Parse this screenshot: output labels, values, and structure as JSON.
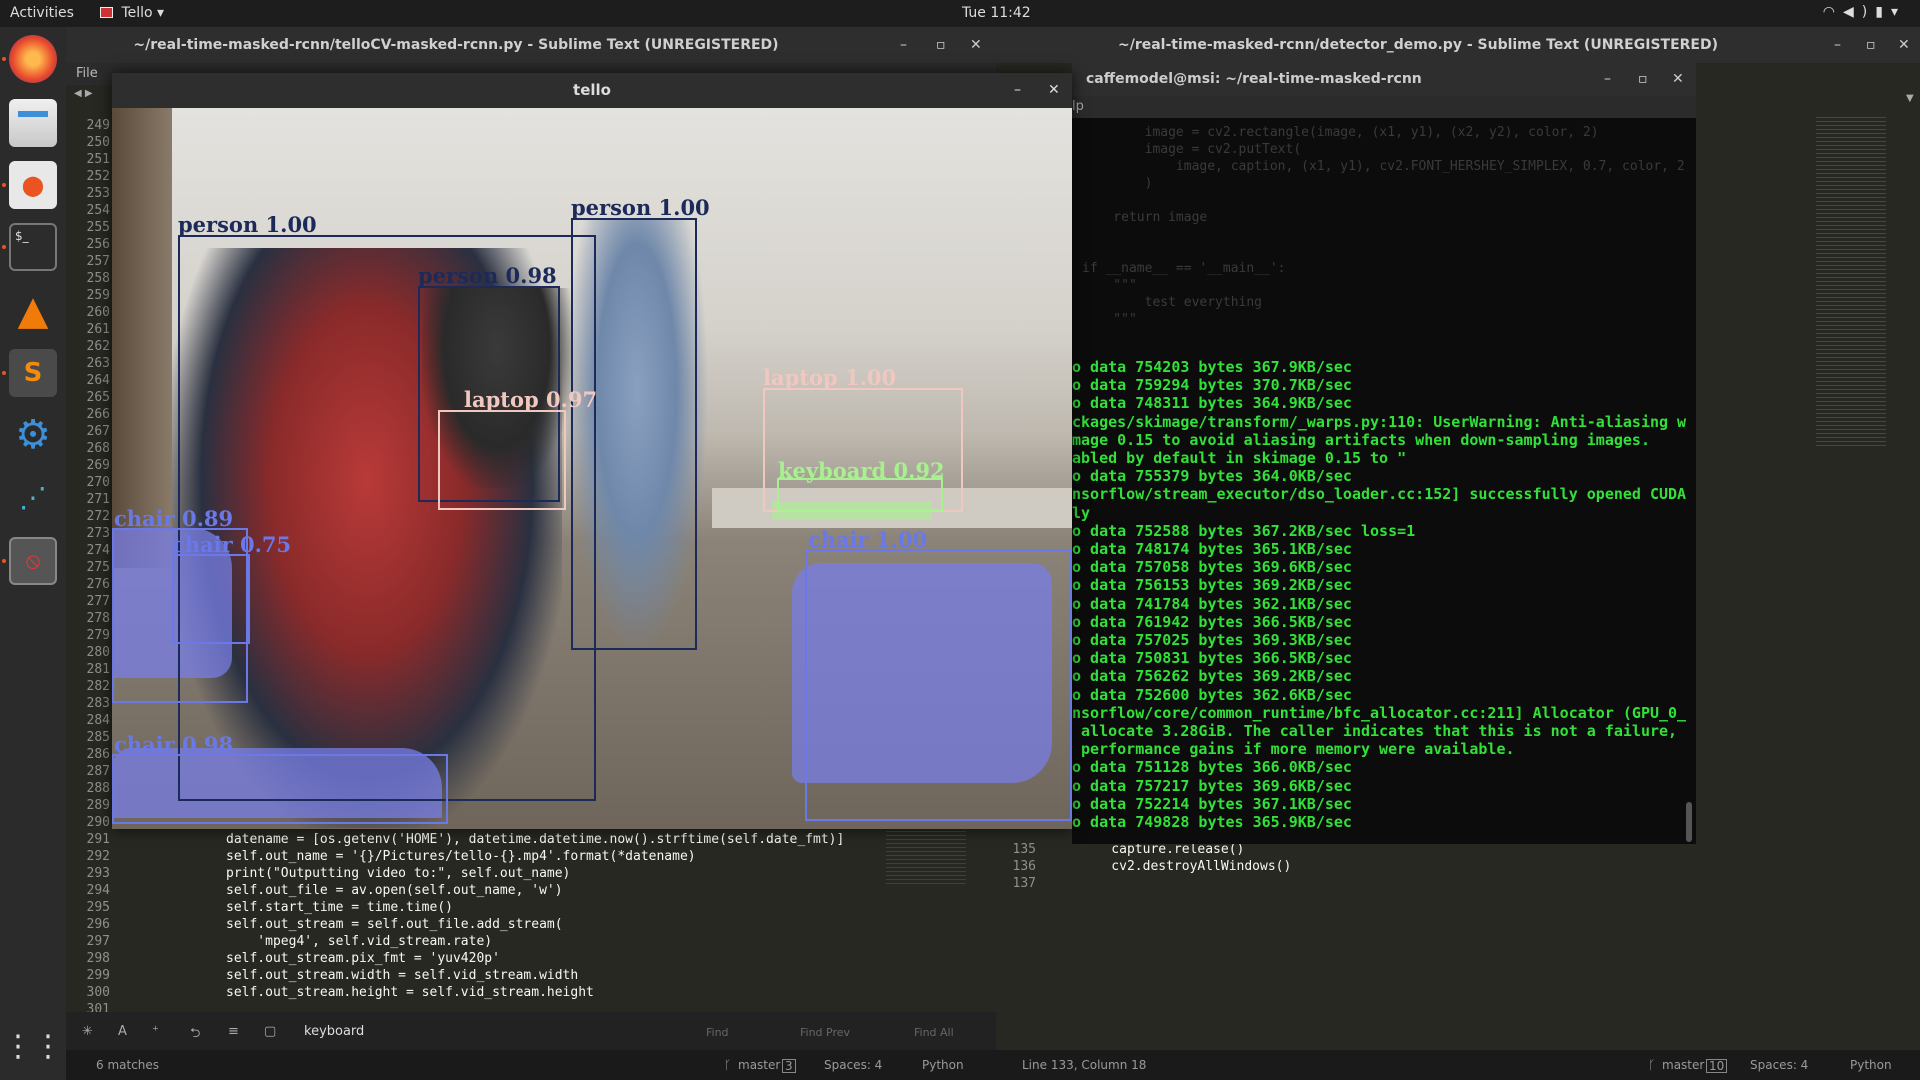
{
  "topbar": {
    "activities": "Activities",
    "app_name": "Tello",
    "clock": "Tue 11:42"
  },
  "dock": {
    "icons": [
      "firefox-icon",
      "files-icon",
      "software-icon",
      "terminal-icon",
      "vlc-icon",
      "sublime-icon",
      "settings-icon",
      "network-icon",
      "blocked-app-icon",
      "app-grid-icon"
    ]
  },
  "editor_left": {
    "title": "~/real-time-masked-rcnn/telloCV-masked-rcnn.py - Sublime Text (UNREGISTERED)",
    "menu_file": "File",
    "line_numbers": [
      "249",
      "250",
      "251",
      "252",
      "253",
      "254",
      "255",
      "256",
      "257",
      "258",
      "259",
      "260",
      "261",
      "262",
      "263",
      "264",
      "265",
      "266",
      "267",
      "268",
      "269",
      "270",
      "271",
      "272",
      "273",
      "274",
      "275",
      "276",
      "277",
      "278",
      "279",
      "280",
      "281",
      "282",
      "283",
      "284",
      "285",
      "286",
      "287",
      "288",
      "289",
      "290",
      "291",
      "292",
      "293",
      "294",
      "295",
      "296",
      "297",
      "298",
      "299",
      "300",
      "301"
    ],
    "code_lines": [
      "datename = [os.getenv('HOME'), datetime.datetime.now().strftime(self.date_fmt)]",
      "self.out_name = '{}/Pictures/tello-{}.mp4'.format(*datename)",
      "print(\"Outputting video to:\", self.out_name)",
      "self.out_file = av.open(self.out_name, 'w')",
      "self.start_time = time.time()",
      "self.out_stream = self.out_file.add_stream(",
      "    'mpeg4', self.vid_stream.rate)",
      "self.out_stream.pix_fmt = 'yuv420p'",
      "self.out_stream.width = self.vid_stream.width",
      "self.out_stream.height = self.vid_stream.height"
    ],
    "find_value": "keyboard",
    "find_label": "Find",
    "find_prev_label": "Find Prev",
    "find_all_label": "Find All",
    "status_matches": "6 matches",
    "status_branch": "master",
    "status_branch_count": "3",
    "status_spaces": "Spaces: 4",
    "status_syntax": "Python"
  },
  "editor_right": {
    "title": "~/real-time-masked-rcnn/detector_demo.py - Sublime Text (UNREGISTERED)",
    "code_top": [
      "        image = cv2.rectangle(image, (x1, y1), (x2, y2), color, 2)",
      "        image = cv2.putText(",
      "            image, caption, (x1, y1), cv2.FONT_HERSHEY_SIMPLEX, 0.7, color, 2",
      "        )",
      "",
      "    return image",
      "",
      "",
      "if __name__ == '__main__':",
      "    \"\"\"",
      "        test everything",
      "    \"\"\""
    ],
    "line_numbers_bottom": [
      "135",
      "136",
      "137"
    ],
    "code_bottom": [
      "    capture.release()",
      "    cv2.destroyAllWindows()",
      ""
    ],
    "status_position": "Line 133, Column 18",
    "status_branch": "master",
    "status_branch_count": "10",
    "status_spaces": "Spaces: 4",
    "status_syntax": "Python"
  },
  "terminal": {
    "title": "caffemodel@msi: ~/real-time-masked-rcnn",
    "menu_help": "lp",
    "lines": [
      "o data 754203 bytes 367.9KB/sec",
      "o data 759294 bytes 370.7KB/sec",
      "o data 748311 bytes 364.9KB/sec",
      "ckages/skimage/transform/_warps.py:110: UserWarning: Anti-aliasing w",
      "mage 0.15 to avoid aliasing artifacts when down-sampling images.",
      "abled by default in skimage 0.15 to \"",
      "o data 755379 bytes 364.0KB/sec",
      "nsorflow/stream_executor/dso_loader.cc:152] successfully opened CUDA",
      "ly",
      "o data 752588 bytes 367.2KB/sec loss=1",
      "o data 748174 bytes 365.1KB/sec",
      "o data 757058 bytes 369.6KB/sec",
      "o data 756153 bytes 369.2KB/sec",
      "o data 741784 bytes 362.1KB/sec",
      "o data 761942 bytes 366.5KB/sec",
      "o data 757025 bytes 369.3KB/sec",
      "o data 750831 bytes 366.5KB/sec",
      "o data 756262 bytes 369.2KB/sec",
      "o data 752600 bytes 362.6KB/sec",
      "nsorflow/core/common_runtime/bfc_allocator.cc:211] Allocator (GPU_0_",
      " allocate 3.28GiB. The caller indicates that this is not a failure,",
      " performance gains if more memory were available.",
      "o data 751128 bytes 366.0KB/sec",
      "o data 757217 bytes 369.6KB/sec",
      "o data 752214 bytes 367.1KB/sec",
      "o data 749828 bytes 365.9KB/sec"
    ]
  },
  "tello": {
    "title": "tello",
    "detections": [
      {
        "label": "person 1.00",
        "color": "#1c2a5a"
      },
      {
        "label": "person 0.98",
        "color": "#1c2a5a"
      },
      {
        "label": "person 1.00",
        "color": "#1c2a5a"
      },
      {
        "label": "laptop 0.97",
        "color": "#f0c8c0"
      },
      {
        "label": "laptop 1.00",
        "color": "#f0c8c0"
      },
      {
        "label": "keyboard 0.92",
        "color": "#a8f090"
      },
      {
        "label": "chair 0.89",
        "color": "#6a78e8"
      },
      {
        "label": "chair 0.75",
        "color": "#6a78e8"
      },
      {
        "label": "chair 1.00",
        "color": "#6a78e8"
      },
      {
        "label": "chair 0.98",
        "color": "#6a78e8"
      }
    ]
  }
}
